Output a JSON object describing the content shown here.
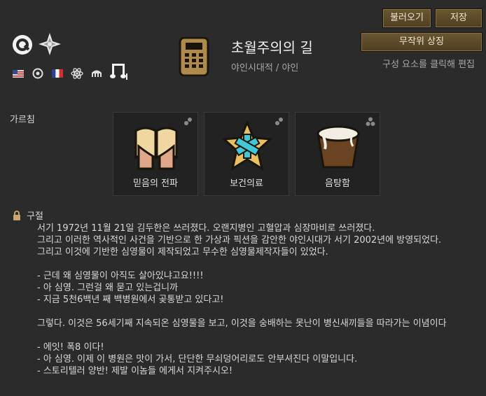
{
  "buttons": {
    "load": "불러오기",
    "save": "저장",
    "randomize": "무작위 상징"
  },
  "edit_hint": "구성 요소를 클릭해 편집",
  "ideo": {
    "title": "초월주의의 길",
    "subtitle": "야인시대적 / 야인"
  },
  "icons": {
    "primary": [
      "target-icon",
      "star-icon"
    ],
    "small": [
      "flag-us-icon",
      "circle-symbol-icon",
      "flag-fr-icon",
      "atom-icon",
      "building-icon",
      "music-note-icon"
    ],
    "center": "calculator-icon"
  },
  "precepts": {
    "label": "가르침",
    "items": [
      {
        "name": "믿음의 전파",
        "icon": "open-book-hands-icon"
      },
      {
        "name": "보건의료",
        "icon": "medical-star-icon"
      },
      {
        "name": "음탕함",
        "icon": "bucket-icon"
      }
    ]
  },
  "scripture": {
    "label": "구절",
    "text": "서기 1972년 11월 21일 김두한은 쓰러졌다. 오랜지병인 고혈압과 심장마비로 쓰러졌다.\n그리고 이러한 역사적인 사건을 기반으로 한 가상과 픽션을 감안한 야인시대가 서기 2002년에 방영되었다.\n그리고 이것에 기반한 심영물이 제작되었고 무수한 심영물제작자들이 있었다.\n\n- 근데 왜 심영물이 아직도 살아있냐고요!!!!\n- 아 심영. 그런걸 왜 묻고 있는겁니까\n- 지금 5천6백년 째 백병원에서 곶통받고 있다고!\n\n그렇다. 이것은 56세기째 지속되온 심영물을 보고, 이것을 숭배하는 못난이 병신새끼들을 따라가는 이념이다\n\n- 에잇! 폭8 이다!\n- 아 심영. 이제 이 병원은 맛이 가서, 단단한 무쇠덩어리로도 안부셔진다 이말입니다.\n- 스토리텔러 양반! 제발 이놈들 에게서 지켜주시오!"
  }
}
